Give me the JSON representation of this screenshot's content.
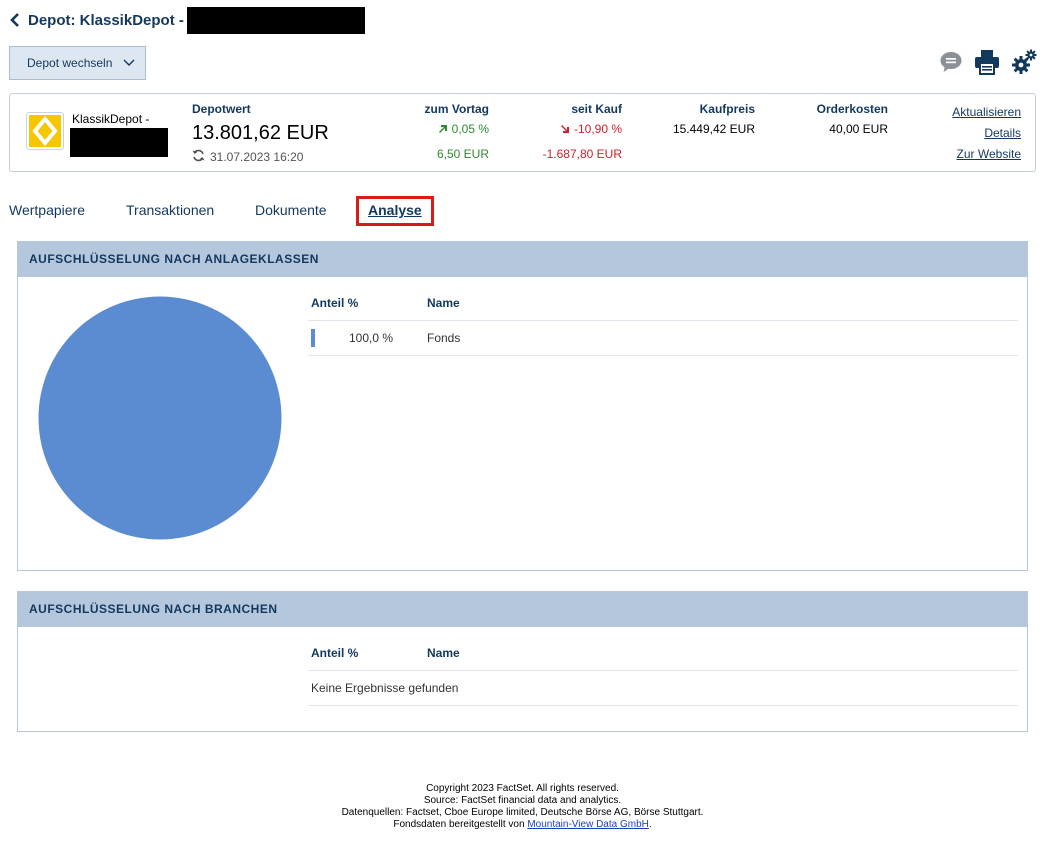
{
  "header": {
    "title": "Depot: KlassikDepot -"
  },
  "depot_switch": {
    "label": "Depot wechseln"
  },
  "icons": {
    "chat": "chat-bubble-icon",
    "print": "printer-icon",
    "settings": "gears-icon"
  },
  "summary": {
    "account_name": "KlassikDepot -",
    "depotwert": {
      "label": "Depotwert",
      "value": "13.801,62 EUR",
      "updated": "31.07.2023 16:20"
    },
    "vortag": {
      "label": "zum Vortag",
      "percent": "0,05 %",
      "amount": "6,50 EUR"
    },
    "seit_kauf": {
      "label": "seit Kauf",
      "percent": "-10,90 %",
      "amount": "-1.687,80 EUR"
    },
    "kaufpreis": {
      "label": "Kaufpreis",
      "value": "15.449,42 EUR"
    },
    "orderkosten": {
      "label": "Orderkosten",
      "value": "40,00 EUR"
    },
    "links": {
      "refresh": "Aktualisieren",
      "details": "Details",
      "website": "Zur Website"
    }
  },
  "tabs": [
    {
      "label": "Wertpapiere"
    },
    {
      "label": "Transaktionen"
    },
    {
      "label": "Dokumente"
    },
    {
      "label": "Analyse"
    }
  ],
  "panel_asset_classes": {
    "title": "AUFSCHLÜSSELUNG NACH ANLAGEKLASSEN",
    "col_share": "Anteil %",
    "col_name": "Name",
    "rows": [
      {
        "share": "100,0 %",
        "name": "Fonds",
        "color": "#5b8bd0"
      }
    ]
  },
  "panel_sectors": {
    "title": "AUFSCHLÜSSELUNG NACH BRANCHEN",
    "col_share": "Anteil %",
    "col_name": "Name",
    "empty": "Keine Ergebnisse gefunden"
  },
  "footer": {
    "line1": "Copyright 2023 FactSet. All rights reserved.",
    "line2": "Source: FactSet financial data and analytics.",
    "line3": "Datenquellen: Factset, Cboe Europe limited, Deutsche Börse AG, Börse Stuttgart.",
    "line4_prefix": "Fondsdaten bereitgestellt von",
    "line4_link": "Mountain-View Data GmbH",
    "line4_suffix": "."
  },
  "chart_data": {
    "type": "pie",
    "categories": [
      "Fonds"
    ],
    "values": [
      100.0
    ]
  }
}
